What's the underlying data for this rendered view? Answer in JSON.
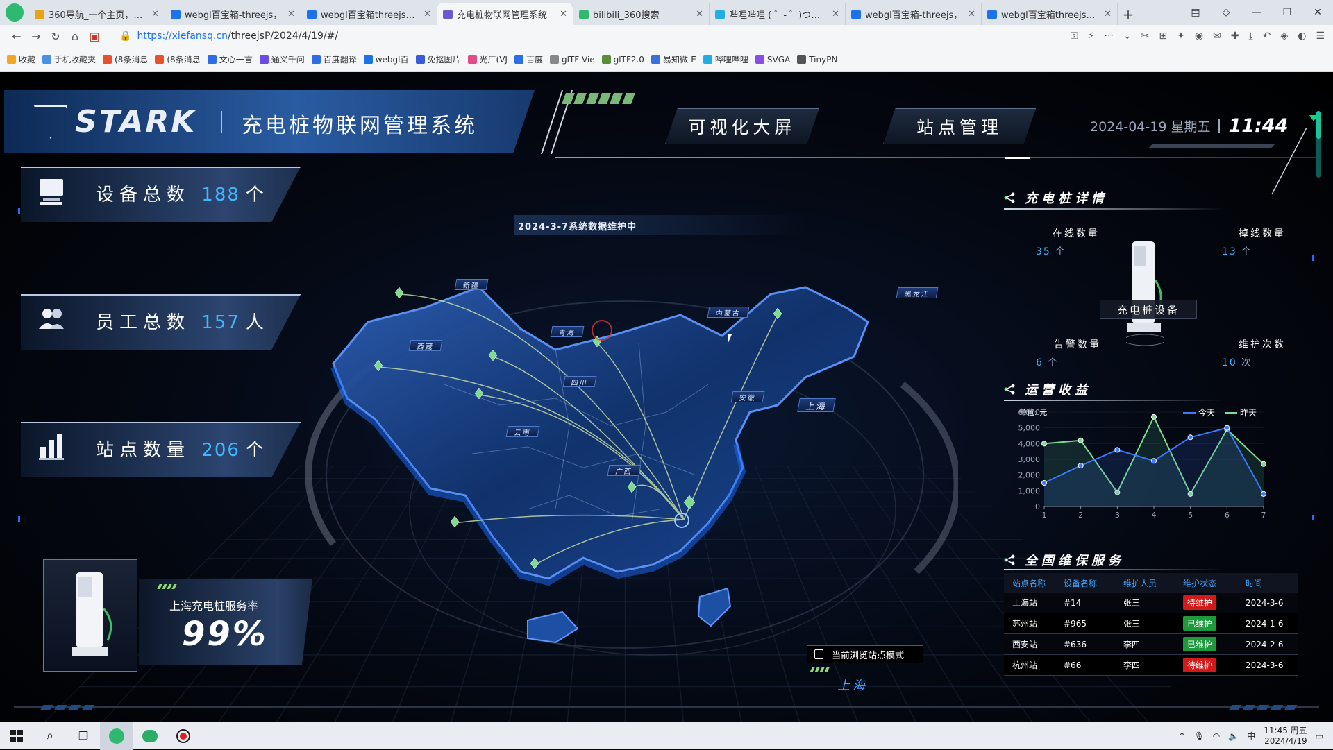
{
  "browser": {
    "tabs": [
      {
        "label": "360导航_一个主页，整个",
        "color": "#e8a317"
      },
      {
        "label": "webgl百宝箱-threejs，",
        "color": "#1a73e8"
      },
      {
        "label": "webgl百宝箱threejs，w",
        "color": "#1a73e8"
      },
      {
        "label": "充电桩物联网管理系统",
        "color": "#6a5acd"
      },
      {
        "label": "bilibili_360搜索",
        "color": "#2fb86f"
      },
      {
        "label": "哔哩哔哩 ( ゜- ゜)つロ 干",
        "color": "#23ade5"
      },
      {
        "label": "webgl百宝箱-threejs，",
        "color": "#1a73e8"
      },
      {
        "label": "webgl百宝箱threejs，w",
        "color": "#1a73e8"
      }
    ],
    "active_tab_index": 3,
    "url_host": "https://xiefansq.cn",
    "url_path": "/threejsP/2024/4/19/#/",
    "bookmarks": [
      {
        "label": "收藏",
        "color": "#f5a623"
      },
      {
        "label": "手机收藏夹",
        "color": "#4a90e2"
      },
      {
        "label": "(8条消息",
        "color": "#e8502f"
      },
      {
        "label": "(8条消息",
        "color": "#e8502f"
      },
      {
        "label": "文心一言",
        "color": "#2d6de5"
      },
      {
        "label": "通义千问",
        "color": "#6b4de6"
      },
      {
        "label": "百度翻译",
        "color": "#2d6de5"
      },
      {
        "label": "webgl百",
        "color": "#1a73e8"
      },
      {
        "label": "免抠图片",
        "color": "#3a5bd9"
      },
      {
        "label": "光厂(VJ",
        "color": "#e34c8a"
      },
      {
        "label": "百度",
        "color": "#2d6de5"
      },
      {
        "label": "glTF Vie",
        "color": "#888888"
      },
      {
        "label": "glTF2.0",
        "color": "#5a8e3a"
      },
      {
        "label": "易知微-E",
        "color": "#3b6fd9"
      },
      {
        "label": "哔哩哔哩",
        "color": "#23ade5"
      },
      {
        "label": "SVGA",
        "color": "#8a4de6"
      },
      {
        "label": "TinyPN",
        "color": "#555555"
      }
    ]
  },
  "dashboard": {
    "brand": "STARK",
    "system_title": "充电桩物联网管理系统",
    "nav": {
      "visual": "可视化大屏",
      "station": "站点管理"
    },
    "date": "2024-04-19 星期五",
    "time": "11:44",
    "notice": "2024-3-7系统数据维护中",
    "stats": [
      {
        "label": "设备总数",
        "value": "188",
        "unit": "个"
      },
      {
        "label": "员工总数",
        "value": "157",
        "unit": "人"
      },
      {
        "label": "站点数量",
        "value": "206",
        "unit": "个"
      }
    ],
    "service_rate": {
      "label": "上海充电桩服务率",
      "value": "99%"
    },
    "provinces": [
      "新疆",
      "西藏",
      "青海",
      "四川",
      "云南",
      "广西",
      "安徽",
      "上海",
      "内蒙古",
      "黑龙江"
    ],
    "browse_mode": "当前浏览站点模式",
    "browse_city": "上海",
    "pile_details": {
      "title": "充电桩详情",
      "device_label": "充电桩设备",
      "online": {
        "label": "在线数量",
        "value": "35",
        "unit": "个"
      },
      "offline": {
        "label": "掉线数量",
        "value": "13",
        "unit": "个"
      },
      "alarm": {
        "label": "告警数量",
        "value": "6",
        "unit": "个"
      },
      "maintain": {
        "label": "维护次数",
        "value": "10",
        "unit": "次"
      }
    },
    "revenue": {
      "title": "运营收益",
      "unit_label": "单位: 元"
    },
    "service": {
      "title": "全国维保服务",
      "columns": [
        "站点名称",
        "设备名称",
        "维护人员",
        "维护状态",
        "时间"
      ],
      "rows": [
        {
          "site": "上海站",
          "device": "#14",
          "person": "张三",
          "status": "待维护",
          "time": "2024-3-6",
          "status_color": "#d11a1a"
        },
        {
          "site": "苏州站",
          "device": "#965",
          "person": "张三",
          "status": "已维护",
          "time": "2024-1-6",
          "status_color": "#1e9a3c"
        },
        {
          "site": "西安站",
          "device": "#636",
          "person": "李四",
          "status": "已维护",
          "time": "2024-2-6",
          "status_color": "#1e9a3c"
        },
        {
          "site": "杭州站",
          "device": "#66",
          "person": "李四",
          "status": "待维护",
          "time": "2024-3-6",
          "status_color": "#d11a1a"
        }
      ]
    }
  },
  "chart_data": {
    "type": "line",
    "x": [
      1,
      2,
      3,
      4,
      5,
      6,
      7
    ],
    "ylim": [
      0,
      6000
    ],
    "yticks": [
      "0",
      "1,000",
      "2,000",
      "3,000",
      "4,000",
      "5,000",
      "6,000"
    ],
    "series": [
      {
        "name": "今天",
        "color": "#3a78ff",
        "values": [
          1500,
          2600,
          3600,
          2900,
          4400,
          5000,
          800
        ]
      },
      {
        "name": "昨天",
        "color": "#7fdc8f",
        "values": [
          4000,
          4200,
          900,
          5700,
          800,
          4900,
          2700
        ]
      }
    ],
    "legend_position": "top-right"
  },
  "taskbar": {
    "time": "11:45 周五",
    "date": "2024/4/19",
    "ime": "中"
  }
}
